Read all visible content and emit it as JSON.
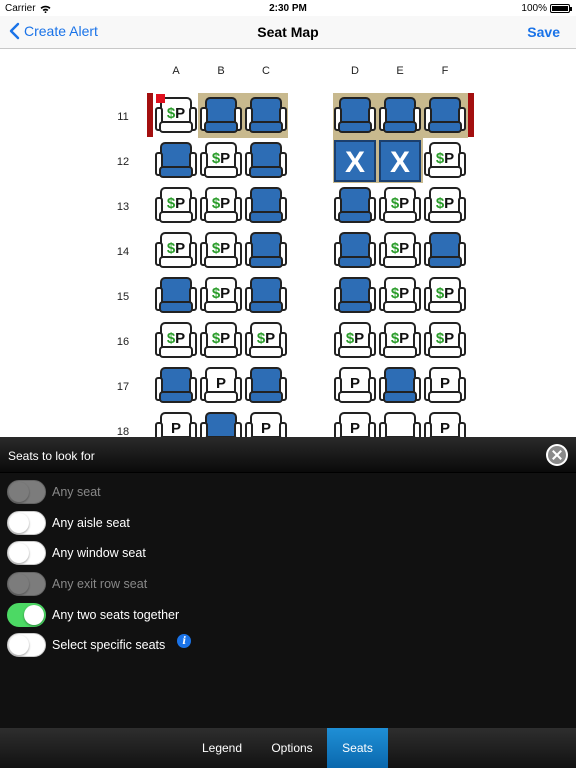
{
  "status_bar": {
    "carrier": "Carrier",
    "time": "2:30 PM",
    "battery": "100%"
  },
  "nav": {
    "back_label": "Create Alert",
    "title": "Seat Map",
    "save_label": "Save"
  },
  "seat_map": {
    "columns": [
      "A",
      "B",
      "C",
      "D",
      "E",
      "F"
    ],
    "rows": [
      "11",
      "12",
      "13",
      "14",
      "15",
      "16",
      "17",
      "18"
    ],
    "seat_code_legend": {
      "O": "occupied",
      "SP": "$P",
      "P": "P",
      "X": "X",
      "E": "empty"
    },
    "seats": [
      [
        "SP",
        "O",
        "O",
        "O",
        "O",
        "O"
      ],
      [
        "O",
        "SP",
        "O",
        "X",
        "X",
        "SP"
      ],
      [
        "SP",
        "SP",
        "O",
        "O",
        "SP",
        "SP"
      ],
      [
        "SP",
        "SP",
        "O",
        "O",
        "SP",
        "O"
      ],
      [
        "O",
        "SP",
        "O",
        "O",
        "SP",
        "SP"
      ],
      [
        "SP",
        "SP",
        "SP",
        "SP",
        "SP",
        "SP"
      ],
      [
        "O",
        "P",
        "O",
        "P",
        "O",
        "P"
      ],
      [
        "P",
        "O",
        "P",
        "P",
        "E",
        "P"
      ]
    ],
    "colors": {
      "seat_blue": "#2d6db5",
      "highlight": "#c8b98e",
      "exit_red": "#a30f0f",
      "dollar_green": "#2a9d2a"
    }
  },
  "panel": {
    "title": "Seats to look for",
    "close_icon": "close-circle-icon",
    "options": [
      {
        "label": "Any seat",
        "on": false,
        "disabled": true
      },
      {
        "label": "Any aisle seat",
        "on": false,
        "disabled": false
      },
      {
        "label": "Any window seat",
        "on": false,
        "disabled": false
      },
      {
        "label": "Any exit row seat",
        "on": false,
        "disabled": true
      },
      {
        "label": "Any two seats together",
        "on": true,
        "disabled": false
      },
      {
        "label": "Select specific seats",
        "on": false,
        "disabled": false
      }
    ],
    "info_glyph": "i"
  },
  "tabs": [
    {
      "label": "Legend",
      "active": false
    },
    {
      "label": "Options",
      "active": false
    },
    {
      "label": "Seats",
      "active": true
    }
  ]
}
